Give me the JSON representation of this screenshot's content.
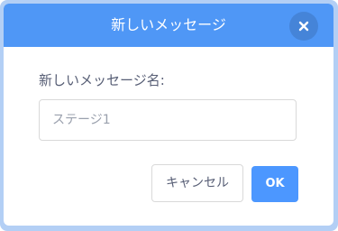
{
  "dialog": {
    "title": "新しいメッセージ",
    "close_icon": "close-icon"
  },
  "form": {
    "label": "新しいメッセージ名:",
    "input_value": "",
    "input_placeholder": "ステージ1"
  },
  "buttons": {
    "cancel_label": "キャンセル",
    "ok_label": "OK"
  },
  "colors": {
    "header": "#4f97f6",
    "ok_button": "#4c97ff",
    "frame": "#b3cff5",
    "text": "#575e75"
  }
}
